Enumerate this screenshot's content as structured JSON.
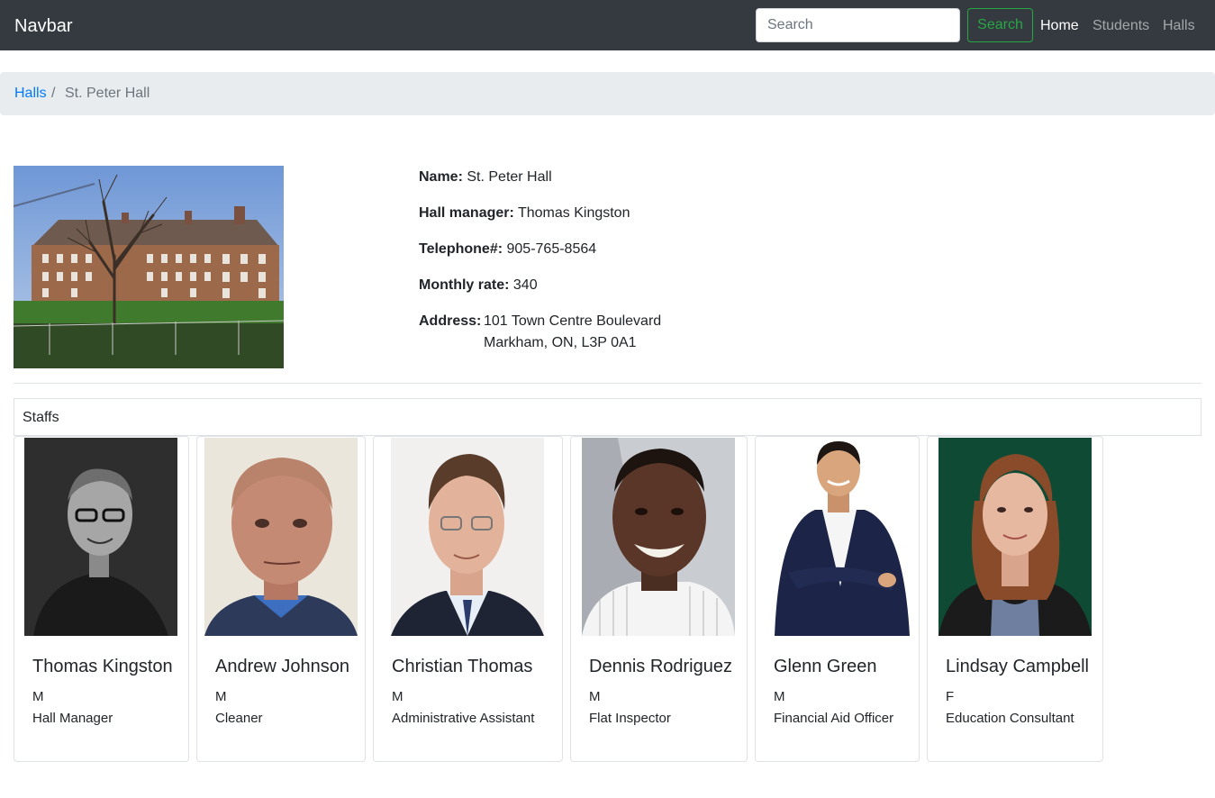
{
  "navbar": {
    "brand": "Navbar",
    "search_placeholder": "Search",
    "search_button": "Search",
    "links": [
      "Home",
      "Students",
      "Halls"
    ]
  },
  "breadcrumb": {
    "parent": "Halls",
    "separator": "/",
    "current": "St. Peter Hall"
  },
  "hall": {
    "name_label": "Name:",
    "name": "St. Peter Hall",
    "manager_label": "Hall manager:",
    "manager": "Thomas Kingston",
    "phone_label": "Telephone#:",
    "phone": "905-765-8564",
    "rate_label": "Monthly rate:",
    "rate": "340",
    "address_label": "Address:",
    "address_line1": "101 Town Centre Boulevard",
    "address_line2": "Markham, ON, L3P 0A1"
  },
  "staff_section": {
    "title": "Staffs"
  },
  "staff": [
    {
      "name": "Thomas Kingston",
      "gender": "M",
      "role": "Hall Manager"
    },
    {
      "name": "Andrew Johnson",
      "gender": "M",
      "role": "Cleaner"
    },
    {
      "name": "Christian Thomas",
      "gender": "M",
      "role": "Administrative Assistant"
    },
    {
      "name": "Dennis Rodriguez",
      "gender": "M",
      "role": "Flat Inspector"
    },
    {
      "name": "Glenn Green",
      "gender": "M",
      "role": "Financial Aid Officer"
    },
    {
      "name": "Lindsay Campbell",
      "gender": "F",
      "role": "Education Consultant"
    }
  ],
  "colors": {
    "navbar_bg": "#343a40",
    "success": "#28a745",
    "link": "#007bff",
    "breadcrumb_bg": "#e9ecef"
  }
}
